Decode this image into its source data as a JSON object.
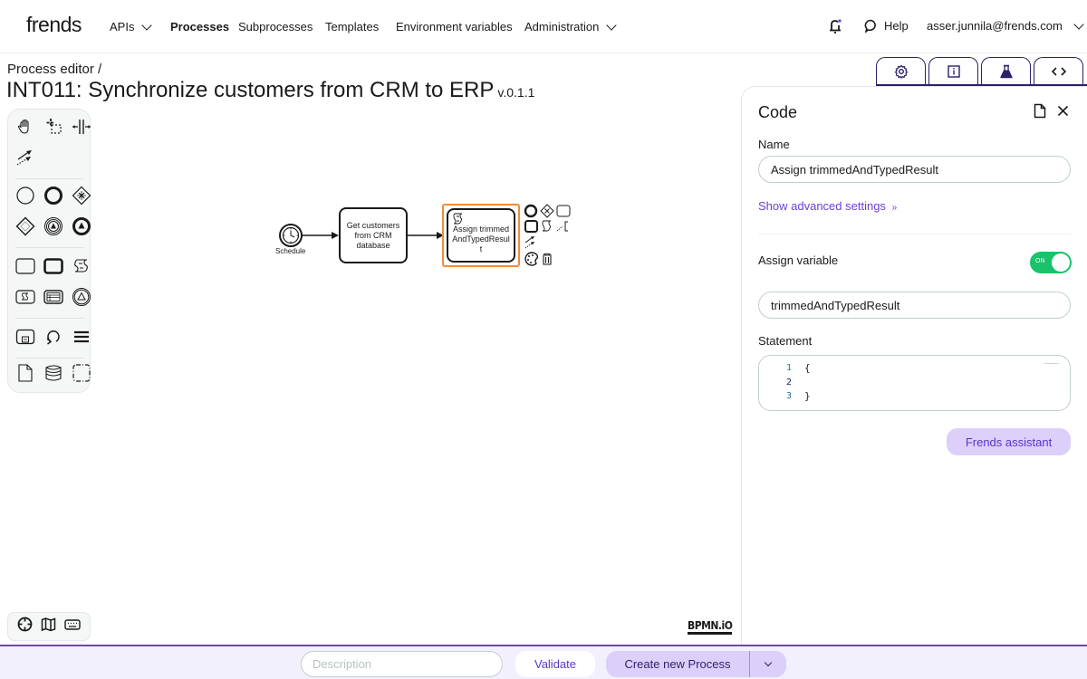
{
  "app": {
    "logo": "frends"
  },
  "nav": {
    "items": [
      {
        "label": "APIs",
        "has_dropdown": true,
        "active": false
      },
      {
        "label": "Processes",
        "has_dropdown": false,
        "active": true
      },
      {
        "label": "Subprocesses",
        "has_dropdown": false,
        "active": false
      },
      {
        "label": "Templates",
        "has_dropdown": false,
        "active": false
      },
      {
        "label": "Environment variables",
        "has_dropdown": false,
        "active": false
      },
      {
        "label": "Administration",
        "has_dropdown": true,
        "active": false
      }
    ],
    "help_label": "Help",
    "user_email": "asser.junnila@frends.com",
    "icons": {
      "notifications": "bell-icon",
      "help": "chat-bubble-icon",
      "user_menu": "chevron-down-icon"
    }
  },
  "header": {
    "breadcrumb": "Process editor /",
    "title": "INT011: Synchronize customers from CRM to ERP",
    "version": "v.0.1.1"
  },
  "panel_tabs": [
    {
      "icon": "gear-icon",
      "name": "settings"
    },
    {
      "icon": "info-icon",
      "name": "info"
    },
    {
      "icon": "flask-icon",
      "name": "test"
    },
    {
      "icon": "code-icon",
      "name": "code"
    }
  ],
  "palette": {
    "groups": [
      [
        "hand-tool-icon",
        "lasso-tool-icon",
        "space-tool-icon"
      ],
      [
        "global-connect-icon"
      ],
      [
        "start-event-icon",
        "end-event-icon",
        "exclusive-gateway-icon"
      ],
      [
        "inclusive-gateway-icon",
        "intermediate-event-icon",
        "signal-end-event-icon"
      ],
      [
        "task-icon",
        "subprocess-icon",
        "code-task-icon"
      ],
      [
        "script-task-icon",
        "api-task-icon",
        "escalation-event-icon"
      ],
      [
        "call-activity-icon",
        "loop-icon",
        "parallel-multi-instance-icon"
      ],
      [
        "data-object-icon",
        "data-store-icon",
        "group-icon"
      ]
    ]
  },
  "diagram": {
    "start_event_label": "Schedule",
    "tasks": [
      {
        "label": "Get customers from CRM database",
        "selected": false
      },
      {
        "label": "Assign trimmedAndTypedResult",
        "selected": true,
        "type": "code"
      }
    ],
    "selection_color": "#f08a3c",
    "watermark": "BPMN.iO"
  },
  "canvas_tools": [
    "recenter-icon",
    "map-icon",
    "keyboard-icon"
  ],
  "properties": {
    "title": "Code",
    "name_label": "Name",
    "name_value": "Assign trimmedAndTypedResult",
    "advanced_link": "Show advanced settings",
    "assign_variable_label": "Assign variable",
    "assign_variable_on": true,
    "toggle_text": "ON",
    "variable_value": "trimmedAndTypedResult",
    "statement_label": "Statement",
    "statement_lines": [
      {
        "num": "1",
        "text": "{"
      },
      {
        "num": "2",
        "text": ""
      },
      {
        "num": "3",
        "text": "}"
      }
    ],
    "assistant_button": "Frends assistant"
  },
  "bottombar": {
    "description_placeholder": "Description",
    "description_value": "",
    "validate_label": "Validate",
    "create_label": "Create new Process"
  },
  "colors": {
    "accent": "#6b3fd8",
    "accent_light": "#dccffa",
    "navy": "#2d1f6b",
    "toggle_on": "#19c26b",
    "selection": "#f08a3c"
  }
}
